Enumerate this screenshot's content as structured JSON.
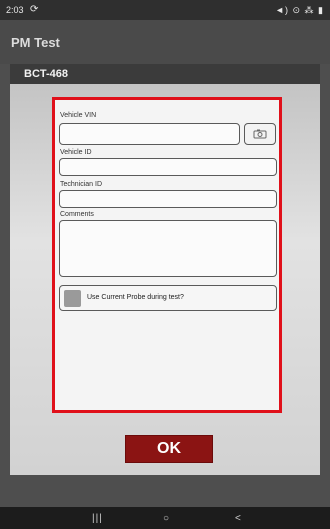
{
  "status_bar": {
    "time": "2:03",
    "sync_icon": "sync-icon",
    "right_icons": "◄) ⊙ ⁂ ▮"
  },
  "app": {
    "title": "PM Test"
  },
  "dialog": {
    "title": "BCT-468",
    "fields": {
      "vin_label": "Vehicle VIN",
      "vin_value": "",
      "vehicle_id_label": "Vehicle ID",
      "vehicle_id_value": "",
      "technician_id_label": "Technician ID",
      "technician_id_value": "",
      "comments_label": "Comments",
      "comments_value": ""
    },
    "probe_checkbox_label": "Use Current Probe during test?",
    "ok_label": "OK"
  },
  "nav": {
    "recent": "|||",
    "home": "○",
    "back": "<"
  },
  "colors": {
    "accent_red": "#e0101a",
    "ok_button": "#8b1413"
  }
}
